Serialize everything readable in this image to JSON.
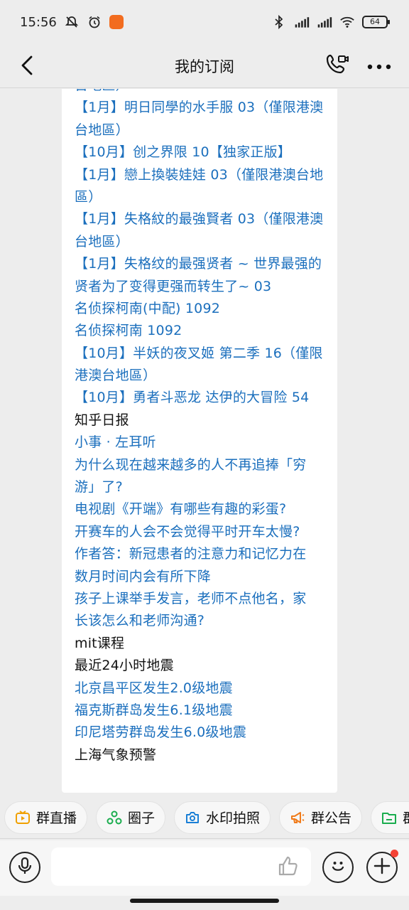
{
  "status_bar": {
    "time": "15:56",
    "left_icons": [
      "mute-icon",
      "alarm-icon",
      "app-badge-icon"
    ],
    "right_icons": [
      "bluetooth-icon",
      "signal-hd-icon",
      "signal-hd-icon",
      "wifi-icon"
    ],
    "battery": "64"
  },
  "header": {
    "title": "我的订阅",
    "icons": [
      "back-icon",
      "call-video-icon",
      "more-icon"
    ]
  },
  "message": {
    "lines": [
      {
        "text": "台地區）",
        "kind": "link"
      },
      {
        "text": "【1月】明日同學的水手服 03（僅限港澳",
        "kind": "link"
      },
      {
        "text": "台地區）",
        "kind": "link"
      },
      {
        "text": "【10月】创之界限 10【独家正版】",
        "kind": "link"
      },
      {
        "text": "【1月】戀上換裝娃娃 03（僅限港澳台地",
        "kind": "link"
      },
      {
        "text": "區）",
        "kind": "link"
      },
      {
        "text": "【1月】失格紋的最強賢者 03（僅限港澳",
        "kind": "link"
      },
      {
        "text": "台地區）",
        "kind": "link"
      },
      {
        "text": "【1月】失格纹的最强贤者 ~ 世界最强的",
        "kind": "link"
      },
      {
        "text": "贤者为了变得更强而转生了~  03",
        "kind": "link"
      },
      {
        "text": "名侦探柯南(中配) 1092",
        "kind": "link"
      },
      {
        "text": "名侦探柯南 1092",
        "kind": "link"
      },
      {
        "text": "【10月】半妖的夜叉姬 第二季 16（僅限",
        "kind": "link"
      },
      {
        "text": "港澳台地區）",
        "kind": "link"
      },
      {
        "text": "【10月】勇者斗恶龙 达伊的大冒险 54",
        "kind": "link"
      },
      {
        "text": "知乎日报",
        "kind": "plain"
      },
      {
        "text": "小事 · 左耳听",
        "kind": "link"
      },
      {
        "text": "为什么现在越来越多的人不再追捧「穷",
        "kind": "link"
      },
      {
        "text": "游」了?",
        "kind": "link"
      },
      {
        "text": "电视剧《开端》有哪些有趣的彩蛋?",
        "kind": "link"
      },
      {
        "text": "开赛车的人会不会觉得平时开车太慢?",
        "kind": "link"
      },
      {
        "text": "作者答：新冠患者的注意力和记忆力在",
        "kind": "link"
      },
      {
        "text": "数月时间内会有所下降",
        "kind": "link"
      },
      {
        "text": "孩子上课举手发言，老师不点他名，家",
        "kind": "link"
      },
      {
        "text": "长该怎么和老师沟通?",
        "kind": "link"
      },
      {
        "text": "mit课程",
        "kind": "plain"
      },
      {
        "text": "最近24小时地震",
        "kind": "plain"
      },
      {
        "text": "北京昌平区发生2.0级地震",
        "kind": "link"
      },
      {
        "text": "福克斯群岛发生6.1级地震",
        "kind": "link"
      },
      {
        "text": "印尼塔劳群岛发生6.0级地震",
        "kind": "link"
      },
      {
        "text": "上海气象预警",
        "kind": "plain"
      }
    ],
    "link_color": "#1b6fbd"
  },
  "quick_actions": [
    {
      "label": "群直播",
      "icon": "live-tv-icon",
      "color": "#f0a000"
    },
    {
      "label": "圈子",
      "icon": "circle-group-icon",
      "color": "#1aad4e"
    },
    {
      "label": "水印拍照",
      "icon": "camera-icon",
      "color": "#1a7fd6"
    },
    {
      "label": "群公告",
      "icon": "megaphone-icon",
      "color": "#f07b1a"
    },
    {
      "label": "群",
      "icon": "folder-icon",
      "color": "#1aad4e"
    }
  ],
  "input_bar": {
    "placeholder": "",
    "icons": [
      "voice-icon",
      "thumbs-up-icon",
      "emoji-icon",
      "plus-icon"
    ]
  }
}
